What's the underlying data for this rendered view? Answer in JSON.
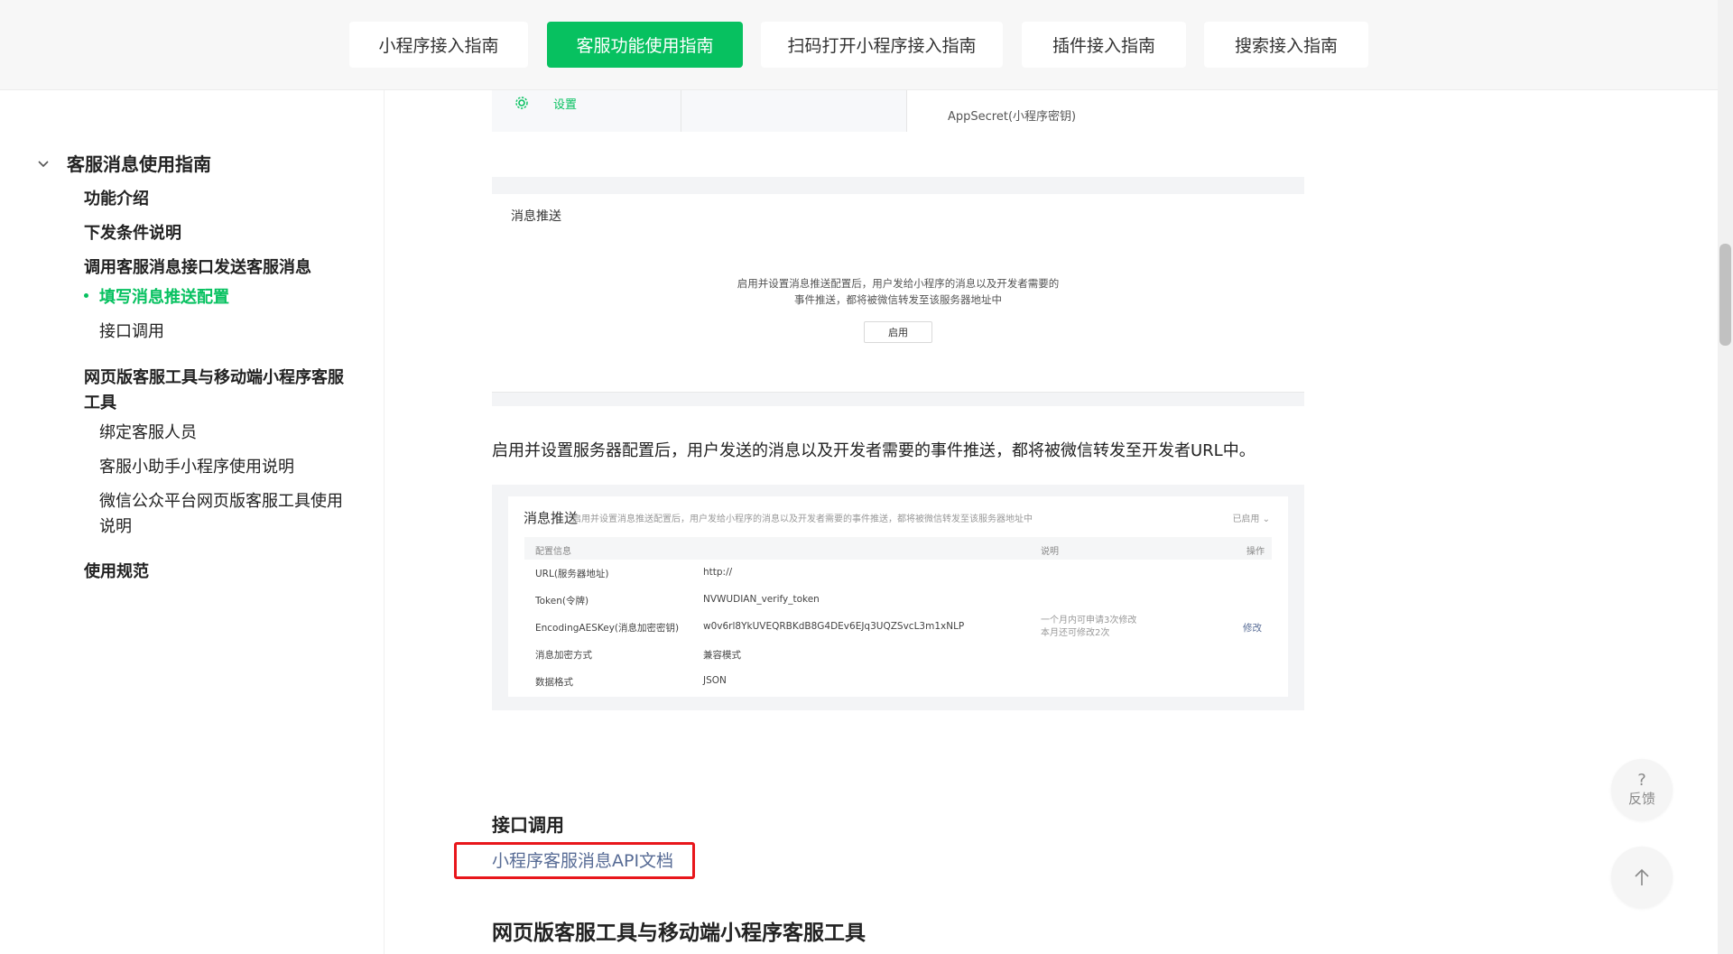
{
  "tabs": [
    {
      "label": "小程序接入指南",
      "active": false
    },
    {
      "label": "客服功能使用指南",
      "active": true
    },
    {
      "label": "扫码打开小程序接入指南",
      "active": false
    },
    {
      "label": "插件接入指南",
      "active": false
    },
    {
      "label": "搜索接入指南",
      "active": false
    }
  ],
  "sidebar": {
    "section_title": "客服消息使用指南",
    "items": [
      {
        "label": "功能介绍"
      },
      {
        "label": "下发条件说明"
      },
      {
        "label": "调用客服消息接口发送客服消息"
      },
      {
        "label": "填写消息推送配置",
        "active": true
      },
      {
        "label": "接口调用"
      },
      {
        "label": "网页版客服工具与移动端小程序客服工具"
      },
      {
        "label": "绑定客服人员"
      },
      {
        "label": "客服小助手小程序使用说明"
      },
      {
        "label": "微信公众平台网页版客服工具使用说明"
      },
      {
        "label": "使用规范"
      }
    ]
  },
  "fragment": {
    "settings_label": "设置",
    "appsecret_label": "AppSecret(小程序密钥)"
  },
  "shot1": {
    "title": "消息推送",
    "desc_line1": "启用并设置消息推送配置后，用户发给小程序的消息以及开发者需要的",
    "desc_line2": "事件推送，都将被微信转发至该服务器地址中",
    "button": "启用"
  },
  "paragraph": "启用并设置服务器配置后，用户发送的消息以及开发者需要的事件推送，都将被微信转发至开发者URL中。",
  "shot2": {
    "title": "消息推送",
    "subtitle": "启用并设置消息推送配置后，用户发给小程序的消息以及开发者需要的事件推送，都将被微信转发至该服务器地址中",
    "enabled": "已启用",
    "headers": [
      "配置信息",
      "说明",
      "操作"
    ],
    "rows": [
      {
        "key": "URL(服务器地址)",
        "value": "http://"
      },
      {
        "key": "Token(令牌)",
        "value": "NVWUDIAN_verify_token"
      },
      {
        "key": "EncodingAESKey(消息加密密钥)",
        "value": "w0v6rl8YkUVEQRBKdB8G4DEv6EJq3UQZSvcL3m1xNLP",
        "note1": "一个月内可申请3次修改",
        "note2": "本月还可修改2次",
        "action": "修改"
      },
      {
        "key": "消息加密方式",
        "value": "兼容模式"
      },
      {
        "key": "数据格式",
        "value": "JSON"
      }
    ]
  },
  "section_interface": "接口调用",
  "api_link": "小程序客服消息API文档",
  "section_web_tools": "网页版客服工具与移动端小程序客服工具",
  "floating": {
    "feedback_icon": "?",
    "feedback_label": "反馈"
  },
  "icons": [
    "chevron-down-icon",
    "gear-icon",
    "arrow-up-icon"
  ],
  "colors": {
    "accent": "#07c160",
    "link": "#576b95",
    "highlight": "#e8161b"
  }
}
